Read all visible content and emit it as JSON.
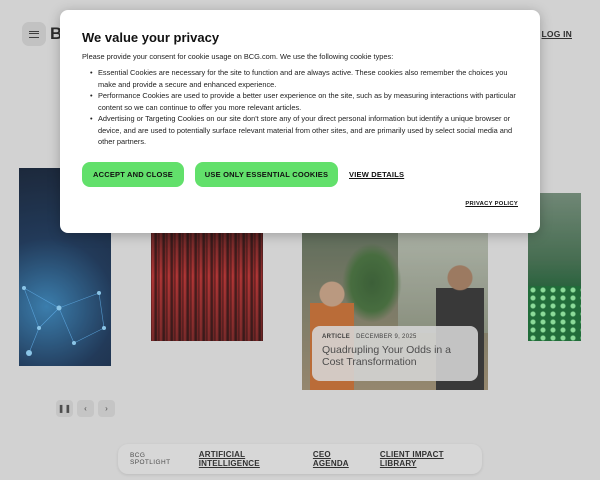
{
  "header": {
    "logo_text": "BC",
    "login_label": "LOG IN"
  },
  "article_card": {
    "type": "ARTICLE",
    "date": "DECEMBER 9, 2025",
    "title": "Quadrupling Your Odds in a Cost Transformation"
  },
  "carousel_controls": {
    "pause_icon": "pause-icon",
    "prev_icon": "chevron-left-icon",
    "next_icon": "chevron-right-icon"
  },
  "spotlight": {
    "label": "BCG SPOTLIGHT",
    "links": [
      "ARTIFICIAL INTELLIGENCE",
      "CEO AGENDA",
      "CLIENT IMPACT LIBRARY"
    ]
  },
  "privacy_modal": {
    "title": "We value your privacy",
    "intro": "Please provide your consent for cookie usage on BCG.com. We use the following cookie types:",
    "items": [
      "Essential Cookies are necessary for the site to function and are always active. These cookies also remember the choices you make and provide a secure and enhanced experience.",
      "Performance Cookies are used to provide a better user experience on the site, such as by measuring interactions with particular content so we can continue to offer you more relevant articles.",
      "Advertising or Targeting Cookies on our site don't store any of your direct personal information but identify a unique browser or device, and are used to potentially surface relevant material from other sites, and are primarily used by select social media and other partners."
    ],
    "accept_label": "ACCEPT AND CLOSE",
    "essential_label": "USE ONLY ESSENTIAL COOKIES",
    "view_details_label": "VIEW DETAILS",
    "policy_label": "PRIVACY POLICY"
  },
  "colors": {
    "accent_green": "#62e06b",
    "page_bg": "#e6e6e6"
  }
}
